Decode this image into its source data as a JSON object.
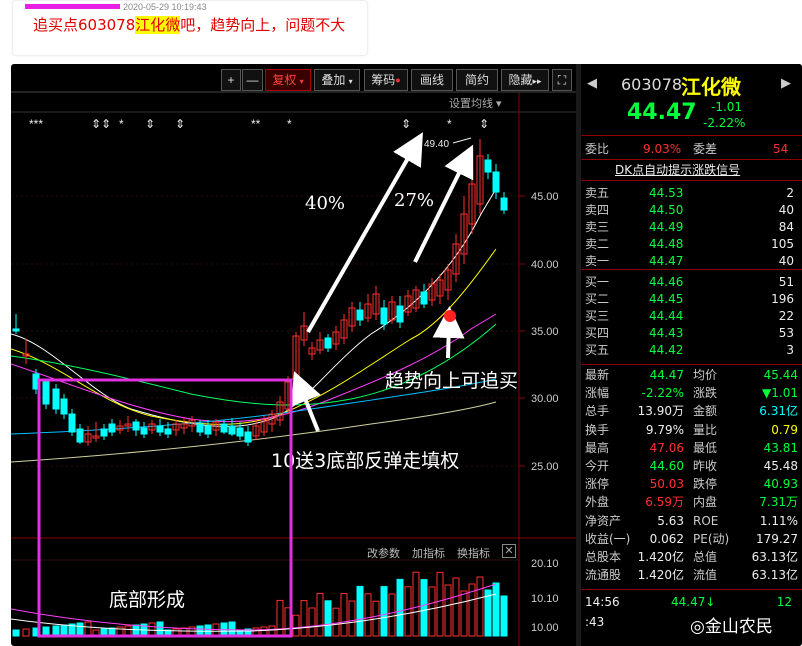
{
  "post": {
    "time": "2020-05-29 10:19:43",
    "text_before": "追买点603078",
    "highlight": "江化微",
    "text_after": "吧，趋势向上，问题不大"
  },
  "toolbar": {
    "plus": "+",
    "minus": "—",
    "fuquan": "复权",
    "diejia": "叠加",
    "chouma": "筹码",
    "huaxian": "画线",
    "jianyue": "简约",
    "yincang": "隐藏",
    "more": "▸▸"
  },
  "setting_ma": "设置均线",
  "price_axis": [
    "45.00",
    "40.00",
    "35.00",
    "30.00",
    "25.00"
  ],
  "volume_axis": [
    "20.10",
    "10.10",
    "10.00"
  ],
  "high_marker": "49.40",
  "annotations": {
    "pct_40": "40%",
    "pct_27": "27%",
    "trend": "趋势向上可追买",
    "rebound": "10送3底部反弹走填权",
    "bottom": "底部形成"
  },
  "sub_tools": {
    "change_param": "改参数",
    "add_indicator": "加指标",
    "switch_indicator": "换指标"
  },
  "watermark": "金山农民",
  "quote": {
    "code": "603078",
    "name": "江化微",
    "price": "44.47",
    "change": "-1.01",
    "change_pct": "-2.22%",
    "weibi_label": "委比",
    "weibi": "9.03%",
    "weicha_label": "委差",
    "weicha": "54",
    "signal": "DK点自动提示涨跌信号",
    "asks": [
      {
        "label": "卖五",
        "price": "44.53",
        "vol": "2"
      },
      {
        "label": "卖四",
        "price": "44.50",
        "vol": "40"
      },
      {
        "label": "卖三",
        "price": "44.49",
        "vol": "84"
      },
      {
        "label": "卖二",
        "price": "44.48",
        "vol": "105"
      },
      {
        "label": "卖一",
        "price": "44.47",
        "vol": "40"
      }
    ],
    "bids": [
      {
        "label": "买一",
        "price": "44.46",
        "vol": "51"
      },
      {
        "label": "买二",
        "price": "44.45",
        "vol": "196"
      },
      {
        "label": "买三",
        "price": "44.44",
        "vol": "22"
      },
      {
        "label": "买四",
        "price": "44.43",
        "vol": "53"
      },
      {
        "label": "买五",
        "price": "44.42",
        "vol": "3"
      }
    ],
    "stats": [
      {
        "l1": "最新",
        "v1": "44.47",
        "c1": "green",
        "l2": "均价",
        "v2": "45.44",
        "c2": "green"
      },
      {
        "l1": "涨幅",
        "v1": "-2.22%",
        "c1": "green",
        "l2": "涨跌",
        "v2": "▼1.01",
        "c2": "green"
      },
      {
        "l1": "总手",
        "v1": "13.90万",
        "c1": "white",
        "l2": "金额",
        "v2": "6.31亿",
        "c2": "cyan"
      },
      {
        "l1": "换手",
        "v1": "9.79%",
        "c1": "white",
        "l2": "量比",
        "v2": "0.79",
        "c2": "yellow"
      },
      {
        "l1": "最高",
        "v1": "47.06",
        "c1": "red",
        "l2": "最低",
        "v2": "43.81",
        "c2": "green"
      },
      {
        "l1": "今开",
        "v1": "44.60",
        "c1": "green",
        "l2": "昨收",
        "v2": "45.48",
        "c2": "white"
      },
      {
        "l1": "涨停",
        "v1": "50.03",
        "c1": "red",
        "l2": "跌停",
        "v2": "40.93",
        "c2": "green"
      },
      {
        "l1": "外盘",
        "v1": "6.59万",
        "c1": "red",
        "l2": "内盘",
        "v2": "7.31万",
        "c2": "green"
      },
      {
        "l1": "净资产",
        "v1": "5.63",
        "c1": "white",
        "l2": "ROE",
        "v2": "1.11%",
        "c2": "white"
      },
      {
        "l1": "收益(一)",
        "v1": "0.062",
        "c1": "white",
        "l2": "PE(动)",
        "v2": "179.27",
        "c2": "white"
      },
      {
        "l1": "总股本",
        "v1": "1.420亿",
        "c1": "white",
        "l2": "总值",
        "v2": "63.13亿",
        "c2": "white"
      },
      {
        "l1": "流通股",
        "v1": "1.420亿",
        "c1": "white",
        "l2": "流值",
        "v2": "63.13亿",
        "c2": "white"
      }
    ],
    "ticks": [
      {
        "time": "14:56",
        "price": "44.47↓",
        "vol": "12"
      },
      {
        "time": ":43",
        "price": "",
        "vol": ""
      }
    ]
  }
}
